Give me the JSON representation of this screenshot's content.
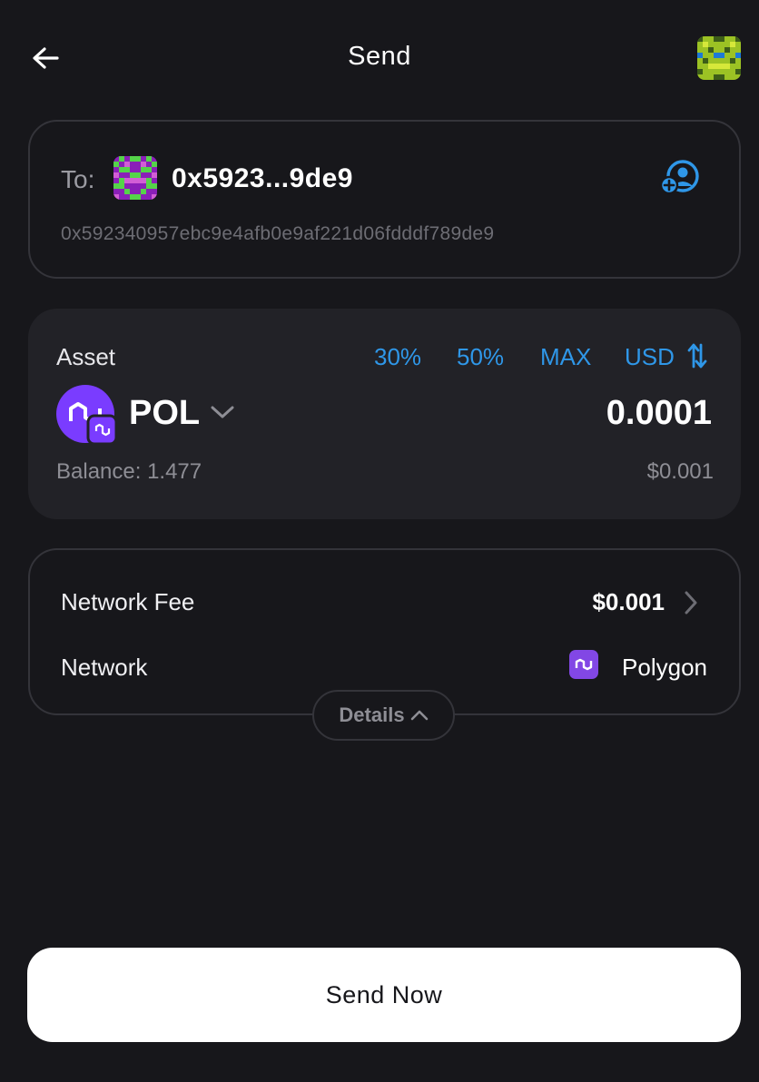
{
  "header": {
    "title": "Send",
    "back_icon": "arrow-left-icon",
    "account_avatar": "identicon-avatar"
  },
  "recipient": {
    "to_label": "To:",
    "short_address": "0x5923...9de9",
    "full_address": "0x592340957ebc9e4afb0e9af221d06fdddf789de9",
    "add_contact_icon": "add-contact-icon"
  },
  "asset": {
    "label": "Asset",
    "quick_amounts": [
      "30%",
      "50%",
      "MAX"
    ],
    "currency_toggle": "USD",
    "token_symbol": "POL",
    "amount": "0.0001",
    "balance": "Balance: 1.477",
    "usd_value": "$0.001"
  },
  "fees": {
    "network_fee_label": "Network Fee",
    "network_fee_value": "$0.001",
    "network_label": "Network",
    "network_value": "Polygon"
  },
  "details_button": "Details",
  "send_button": "Send Now",
  "colors": {
    "background": "#17171b",
    "card": "#222227",
    "border": "#34343a",
    "accent": "#2f97e8",
    "polygon": "#8247e5"
  }
}
